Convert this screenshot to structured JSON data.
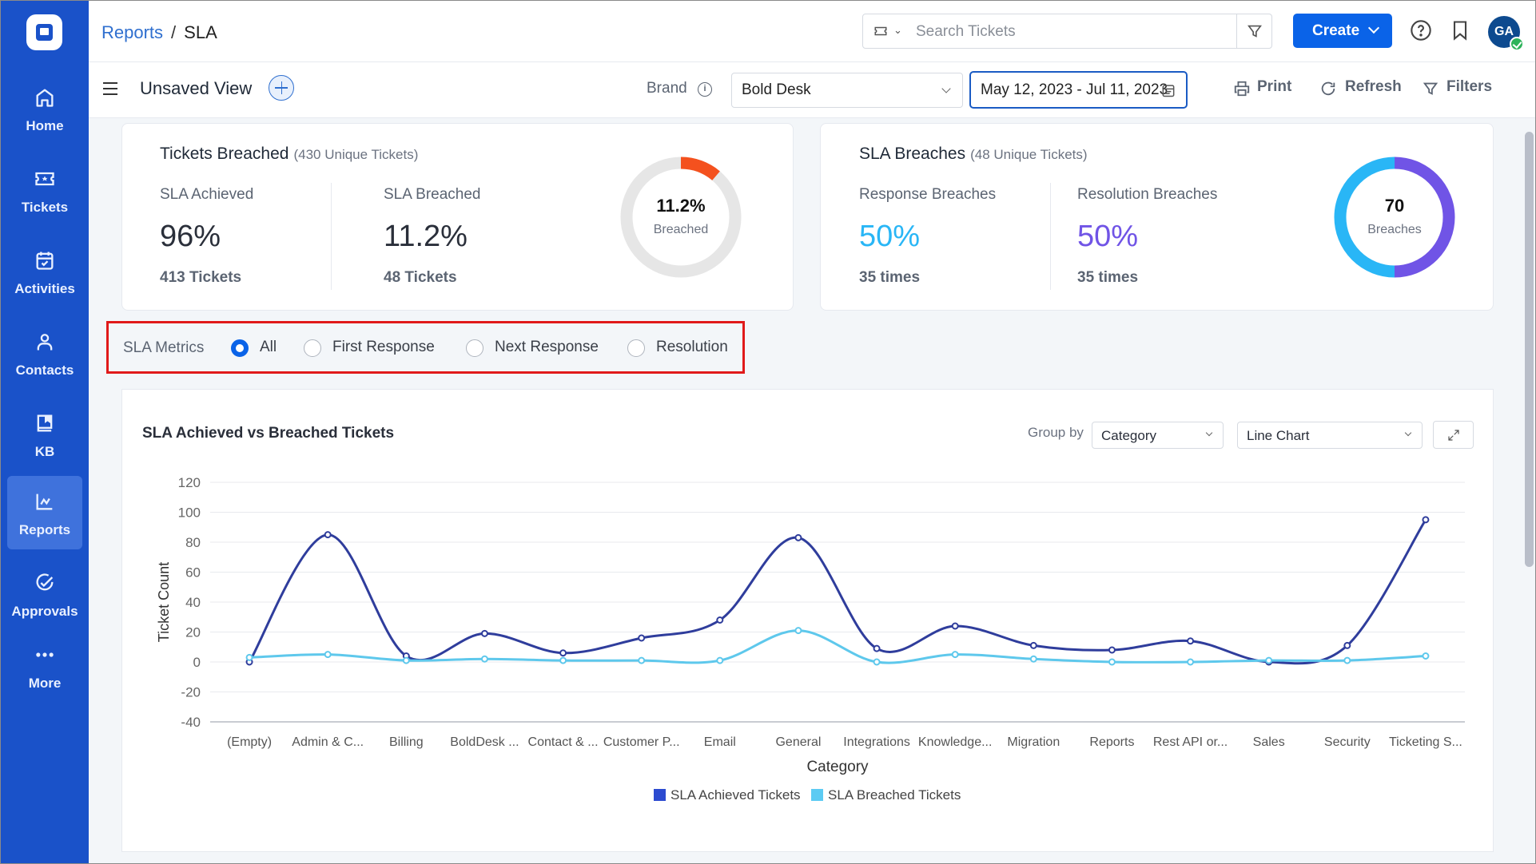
{
  "app": {
    "breadcrumb": {
      "parent": "Reports",
      "separator": "/",
      "current": "SLA"
    },
    "search": {
      "placeholder": "Search Tickets"
    },
    "create_label": "Create",
    "avatar_initials": "GA"
  },
  "sidebar": {
    "items": [
      {
        "label": "Home",
        "icon": "home-icon"
      },
      {
        "label": "Tickets",
        "icon": "ticket-icon"
      },
      {
        "label": "Activities",
        "icon": "calendar-check-icon"
      },
      {
        "label": "Contacts",
        "icon": "user-icon"
      },
      {
        "label": "KB",
        "icon": "book-icon"
      },
      {
        "label": "Reports",
        "icon": "chart-line-icon",
        "active": true
      },
      {
        "label": "Approvals",
        "icon": "check-circle-icon"
      },
      {
        "label": "More",
        "icon": "more-dots-icon"
      }
    ]
  },
  "toolbar": {
    "view_title": "Unsaved View",
    "brand_label": "Brand",
    "brand_value": "Bold Desk",
    "date_range": "May 12, 2023 - Jul 11, 2023",
    "print_label": "Print",
    "refresh_label": "Refresh",
    "filters_label": "Filters"
  },
  "tickets_breached_card": {
    "title": "Tickets Breached",
    "subtitle": "(430 Unique Tickets)",
    "achieved_label": "SLA Achieved",
    "achieved_value": "96%",
    "achieved_count": "413 Tickets",
    "breached_label": "SLA Breached",
    "breached_value": "11.2%",
    "breached_count": "48 Tickets",
    "donut_value": "11.2%",
    "donut_label": "Breached",
    "donut_fraction": 0.112,
    "colors": {
      "breached": "#f4511e",
      "rest": "#e6e6e6"
    }
  },
  "sla_breaches_card": {
    "title": "SLA Breaches",
    "subtitle": "(48 Unique Tickets)",
    "response_label": "Response Breaches",
    "response_value": "50%",
    "response_count": "35 times",
    "resolution_label": "Resolution Breaches",
    "resolution_value": "50%",
    "resolution_count": "35 times",
    "donut_value": "70",
    "donut_label": "Breaches",
    "donut_fractions": {
      "response": 0.5,
      "resolution": 0.5
    },
    "colors": {
      "response": "#29b6f6",
      "resolution": "#7054e6"
    }
  },
  "sla_metrics": {
    "label": "SLA Metrics",
    "options": [
      "All",
      "First Response",
      "Next Response",
      "Resolution"
    ],
    "selected": "All"
  },
  "chart_panel": {
    "title": "SLA Achieved vs Breached Tickets",
    "group_by_label": "Group by",
    "group_by_value": "Category",
    "chart_type_value": "Line Chart"
  },
  "chart_data": {
    "type": "line",
    "title": "SLA Achieved vs Breached Tickets",
    "xlabel": "Category",
    "ylabel": "Ticket Count",
    "ylim": [
      -40,
      120
    ],
    "yticks": [
      -40,
      -20,
      0,
      20,
      40,
      60,
      80,
      100,
      120
    ],
    "grid": true,
    "legend_position": "bottom-center",
    "categories": [
      "(Empty)",
      "Admin & C...",
      "Billing",
      "BoldDesk ...",
      "Contact & ...",
      "Customer P...",
      "Email",
      "General",
      "Integrations",
      "Knowledge...",
      "Migration",
      "Reports",
      "Rest API or...",
      "Sales",
      "Security",
      "Ticketing S..."
    ],
    "series": [
      {
        "name": "SLA Achieved Tickets",
        "color": "#2f3d9c",
        "legend_color": "#2c4bd0",
        "values": [
          0,
          85,
          4,
          19,
          6,
          16,
          28,
          83,
          9,
          24,
          11,
          8,
          14,
          0,
          11,
          95
        ]
      },
      {
        "name": "SLA Breached Tickets",
        "color": "#5ec8ec",
        "legend_color": "#5ccbf3",
        "values": [
          3,
          5,
          1,
          2,
          1,
          1,
          1,
          21,
          0,
          5,
          2,
          0,
          0,
          1,
          1,
          4
        ]
      }
    ]
  }
}
